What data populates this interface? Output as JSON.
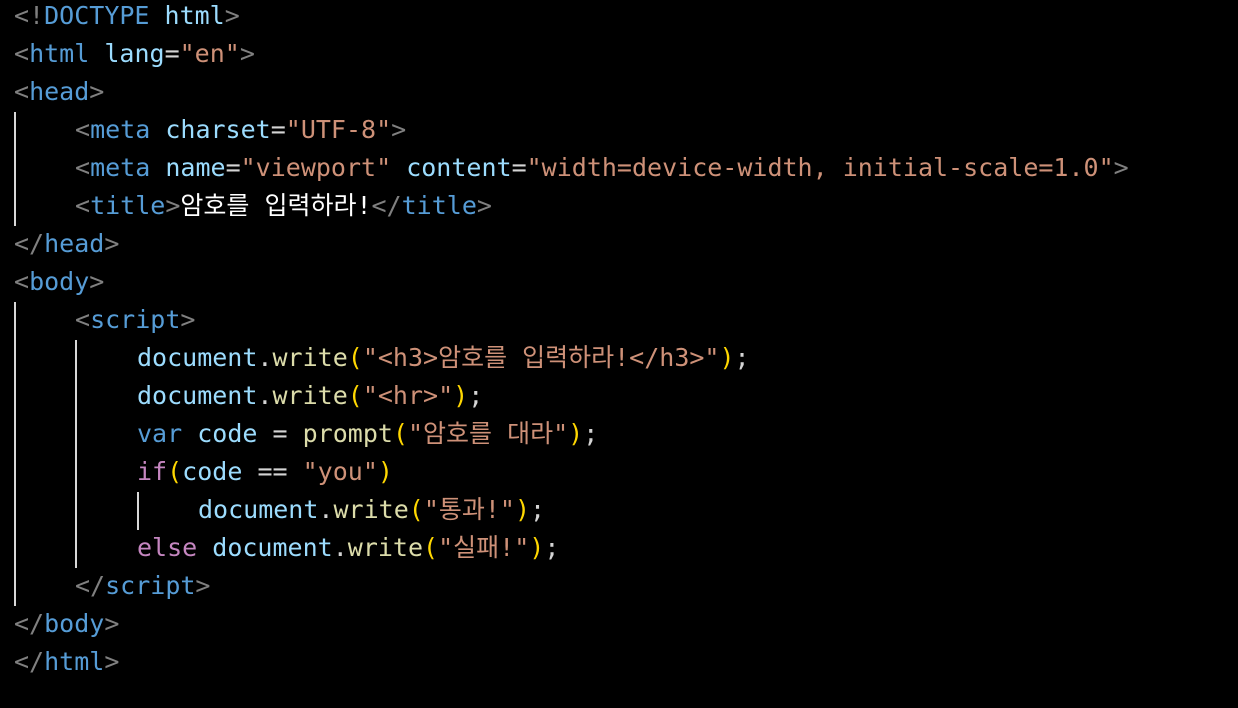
{
  "colors": {
    "background": "#000000",
    "html_bracket": "#808080",
    "html_tag": "#569cd6",
    "attribute": "#9cdcfe",
    "string": "#ce9178",
    "identifier": "#9cdcfe",
    "function": "#dcdcaa",
    "keyword_control": "#c586c0",
    "keyword_declaration": "#569cd6",
    "bracket_pair": "#ffd700",
    "indent_guide": "#d8d8d8"
  },
  "code": {
    "doctype": {
      "open": "<!",
      "keyword": "DOCTYPE",
      "value": "html",
      "close": ">"
    },
    "html_open": {
      "tag": "html",
      "attr": "lang",
      "value": "\"en\""
    },
    "head_tag": "head",
    "meta_charset": {
      "tag": "meta",
      "attr": "charset",
      "value": "\"UTF-8\""
    },
    "meta_viewport": {
      "tag": "meta",
      "attr1": "name",
      "value1": "\"viewport\"",
      "attr2": "content",
      "value2": "\"width=device-width, initial-scale=1.0\""
    },
    "title": {
      "tag": "title",
      "text": "암호를 입력하라!"
    },
    "body_tag": "body",
    "script_tag": "script",
    "line_write_h3": {
      "object": "document",
      "method": "write",
      "arg": "\"<h3>암호를 입력하라!</h3>\""
    },
    "line_write_hr": {
      "object": "document",
      "method": "write",
      "arg": "\"<hr>\""
    },
    "line_prompt": {
      "keyword": "var",
      "name": "code",
      "op": "=",
      "func": "prompt",
      "arg": "\"암호를 대라\""
    },
    "line_if": {
      "keyword": "if",
      "var": "code",
      "op": "==",
      "value": "\"you\""
    },
    "line_pass": {
      "object": "document",
      "method": "write",
      "arg": "\"통과!\""
    },
    "line_else": {
      "keyword": "else",
      "object": "document",
      "method": "write",
      "arg": "\"실패!\""
    }
  }
}
